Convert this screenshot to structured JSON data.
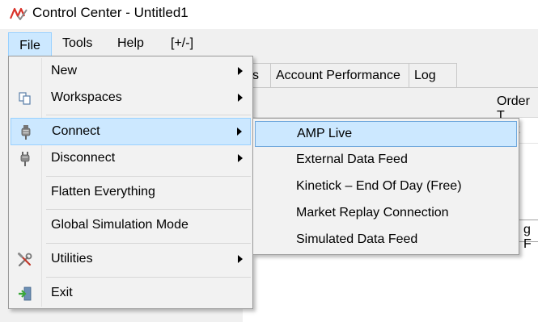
{
  "window": {
    "title": "Control Center - Untitled1",
    "icon": "ninjatrader-logo-icon"
  },
  "menubar": {
    "items": [
      {
        "label": "File",
        "active": true
      },
      {
        "label": "Tools"
      },
      {
        "label": "Help"
      },
      {
        "label": "[+/-]"
      }
    ]
  },
  "background": {
    "tabs": [
      "s",
      "Account Performance",
      "Log"
    ],
    "order_label": "Order T",
    "col_t": "t",
    "field_text": "g F"
  },
  "file_menu": {
    "items": [
      {
        "label": "New",
        "icon": null,
        "submenu": true
      },
      {
        "label": "Workspaces",
        "icon": "workspaces-icon",
        "submenu": true
      },
      {
        "label": "Connect",
        "icon": "connect-plug-icon",
        "submenu": true,
        "highlighted": true
      },
      {
        "label": "Disconnect",
        "icon": "disconnect-plug-icon",
        "submenu": true
      },
      {
        "label": "Flatten Everything",
        "icon": null
      },
      {
        "label": "Global Simulation Mode",
        "icon": null
      },
      {
        "label": "Utilities",
        "icon": "utilities-tools-icon",
        "submenu": true
      },
      {
        "label": "Exit",
        "icon": "exit-door-icon"
      }
    ]
  },
  "connect_submenu": {
    "items": [
      {
        "label": "AMP Live",
        "highlighted": true
      },
      {
        "label": "External Data Feed"
      },
      {
        "label": "Kinetick – End Of Day (Free)"
      },
      {
        "label": "Market Replay Connection"
      },
      {
        "label": "Simulated Data Feed"
      }
    ]
  },
  "colors": {
    "highlight_bg": "#cce8ff",
    "highlight_border": "#99d1ff",
    "menu_bg": "#f2f2f2"
  }
}
